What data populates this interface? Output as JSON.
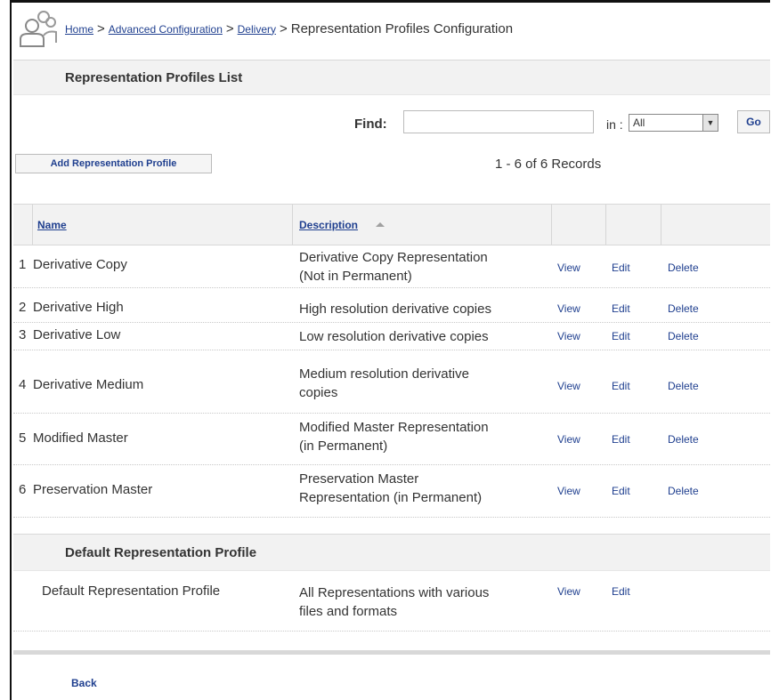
{
  "breadcrumb": {
    "home": "Home",
    "advanced": "Advanced Configuration",
    "delivery": "Delivery",
    "current": "Representation Profiles Configuration",
    "separator": ">"
  },
  "list_section": {
    "title": "Representation Profiles List"
  },
  "search": {
    "find_label": "Find:",
    "query": "",
    "in_label": "in :",
    "scope_selected": "All",
    "go_label": "Go"
  },
  "toolbar": {
    "add_label": "Add Representation Profile"
  },
  "records_label": "1 - 6 of 6 Records",
  "table": {
    "col_name": "Name",
    "col_description": "Description",
    "rows": [
      {
        "num": "1",
        "name": "Derivative Copy",
        "desc1": "Derivative Copy Representation",
        "desc2": "(Not in Permanent)",
        "view": "View",
        "edit": "Edit",
        "delete": "Delete"
      },
      {
        "num": "2",
        "name": "Derivative High",
        "desc1": "High resolution derivative copies",
        "desc2": "",
        "view": "View",
        "edit": "Edit",
        "delete": "Delete"
      },
      {
        "num": "3",
        "name": "Derivative Low",
        "desc1": "Low resolution derivative copies",
        "desc2": "",
        "view": "View",
        "edit": "Edit",
        "delete": "Delete"
      },
      {
        "num": "4",
        "name": "Derivative Medium",
        "desc1": "Medium resolution derivative",
        "desc2": "copies",
        "view": "View",
        "edit": "Edit",
        "delete": "Delete"
      },
      {
        "num": "5",
        "name": "Modified Master",
        "desc1": "Modified Master Representation",
        "desc2": "(in Permanent)",
        "view": "View",
        "edit": "Edit",
        "delete": "Delete"
      },
      {
        "num": "6",
        "name": "Preservation Master",
        "desc1": "Preservation Master",
        "desc2": "Representation (in Permanent)",
        "view": "View",
        "edit": "Edit",
        "delete": "Delete"
      }
    ]
  },
  "default_section": {
    "title": "Default Representation Profile",
    "row": {
      "name": "Default Representation Profile",
      "desc1": "All Representations with various",
      "desc2": "files and formats",
      "view": "View",
      "edit": "Edit"
    }
  },
  "footer": {
    "back_label": "Back"
  },
  "colors": {
    "link": "#1f3f8f",
    "header_bg": "#f2f2f2",
    "text": "#333333"
  }
}
